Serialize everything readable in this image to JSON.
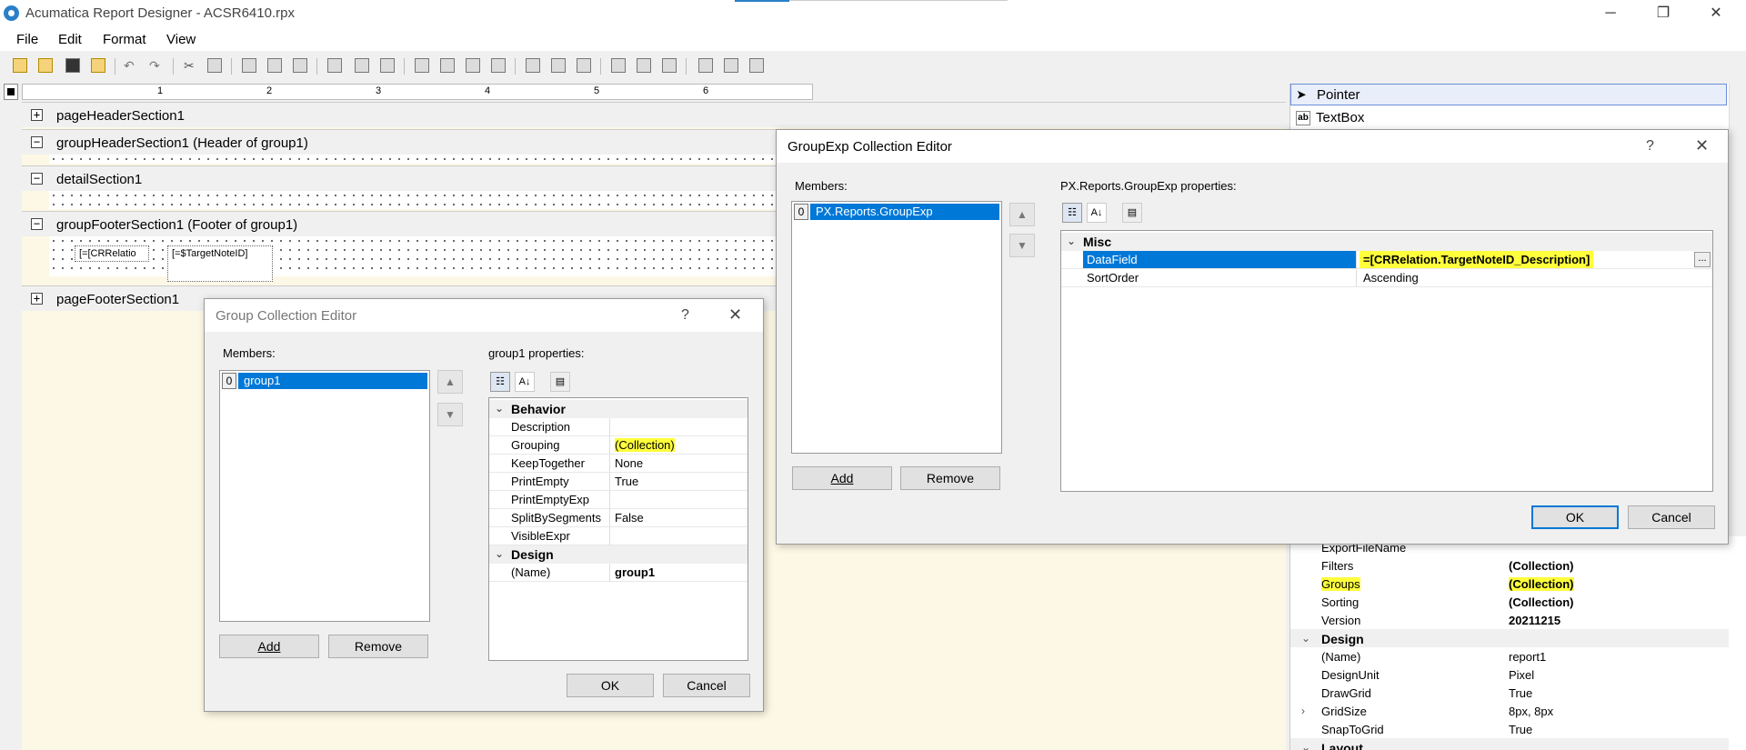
{
  "window": {
    "title": "Acumatica Report Designer - ACSR6410.rpx"
  },
  "menu": [
    "File",
    "Edit",
    "Format",
    "View"
  ],
  "ruler": {
    "numbers": [
      "1",
      "2",
      "3",
      "4",
      "5",
      "6"
    ]
  },
  "sections": {
    "page_header": "pageHeaderSection1",
    "group_header": "groupHeaderSection1 (Header of group1)",
    "detail": "detailSection1",
    "group_footer": "groupFooterSection1 (Footer of group1)",
    "page_footer": "pageFooterSection1"
  },
  "fields": {
    "f1": "[=[CRRelatio",
    "f2": "[=$TargetNoteID]"
  },
  "toolbox": {
    "items": [
      "Pointer",
      "TextBox"
    ],
    "textbox_icon": "ab"
  },
  "group_editor": {
    "title": "Group Collection Editor",
    "help": "?",
    "close": "✕",
    "members_label": "Members:",
    "members": [
      {
        "index": "0",
        "name": "group1"
      }
    ],
    "props_label": "group1 properties:",
    "categories": {
      "behavior": "Behavior",
      "design": "Design"
    },
    "behavior_rows": [
      {
        "key": "Description",
        "value": ""
      },
      {
        "key": "Grouping",
        "value": "(Collection)"
      },
      {
        "key": "KeepTogether",
        "value": "None"
      },
      {
        "key": "PrintEmpty",
        "value": "True"
      },
      {
        "key": "PrintEmptyExp",
        "value": ""
      },
      {
        "key": "SplitBySegments",
        "value": "False"
      },
      {
        "key": "VisibleExpr",
        "value": ""
      }
    ],
    "design_rows": [
      {
        "key": "(Name)",
        "value": "group1"
      }
    ],
    "add": "Add",
    "remove": "Remove",
    "ok": "OK",
    "cancel": "Cancel"
  },
  "groupexp_editor": {
    "title": "GroupExp Collection Editor",
    "help": "?",
    "close": "✕",
    "members_label": "Members:",
    "members": [
      {
        "index": "0",
        "name": "PX.Reports.GroupExp"
      }
    ],
    "props_label": "PX.Reports.GroupExp properties:",
    "category": "Misc",
    "rows": [
      {
        "key": "DataField",
        "value": "=[CRRelation.TargetNoteID_Description]"
      },
      {
        "key": "SortOrder",
        "value": "Ascending"
      }
    ],
    "ellipsis": "...",
    "add": "Add",
    "remove": "Remove",
    "ok": "OK",
    "cancel": "Cancel"
  },
  "report_props": {
    "rows": [
      {
        "key": "ExportFileName",
        "value": ""
      },
      {
        "key": "Filters",
        "value": "(Collection)"
      },
      {
        "key": "Groups",
        "value": "(Collection)"
      },
      {
        "key": "Sorting",
        "value": "(Collection)"
      },
      {
        "key": "Version",
        "value": "20211215"
      }
    ],
    "design_category": "Design",
    "design_rows": [
      {
        "key": "(Name)",
        "value": "report1"
      },
      {
        "key": "DesignUnit",
        "value": "Pixel"
      },
      {
        "key": "DrawGrid",
        "value": "True"
      },
      {
        "key": "GridSize",
        "value": "8px, 8px"
      },
      {
        "key": "SnapToGrid",
        "value": "True"
      }
    ],
    "layout_category": "Layout"
  },
  "colors": {
    "selection": "#0078d7",
    "highlight": "#ffff3c",
    "canvas": "#fdf8e6"
  }
}
